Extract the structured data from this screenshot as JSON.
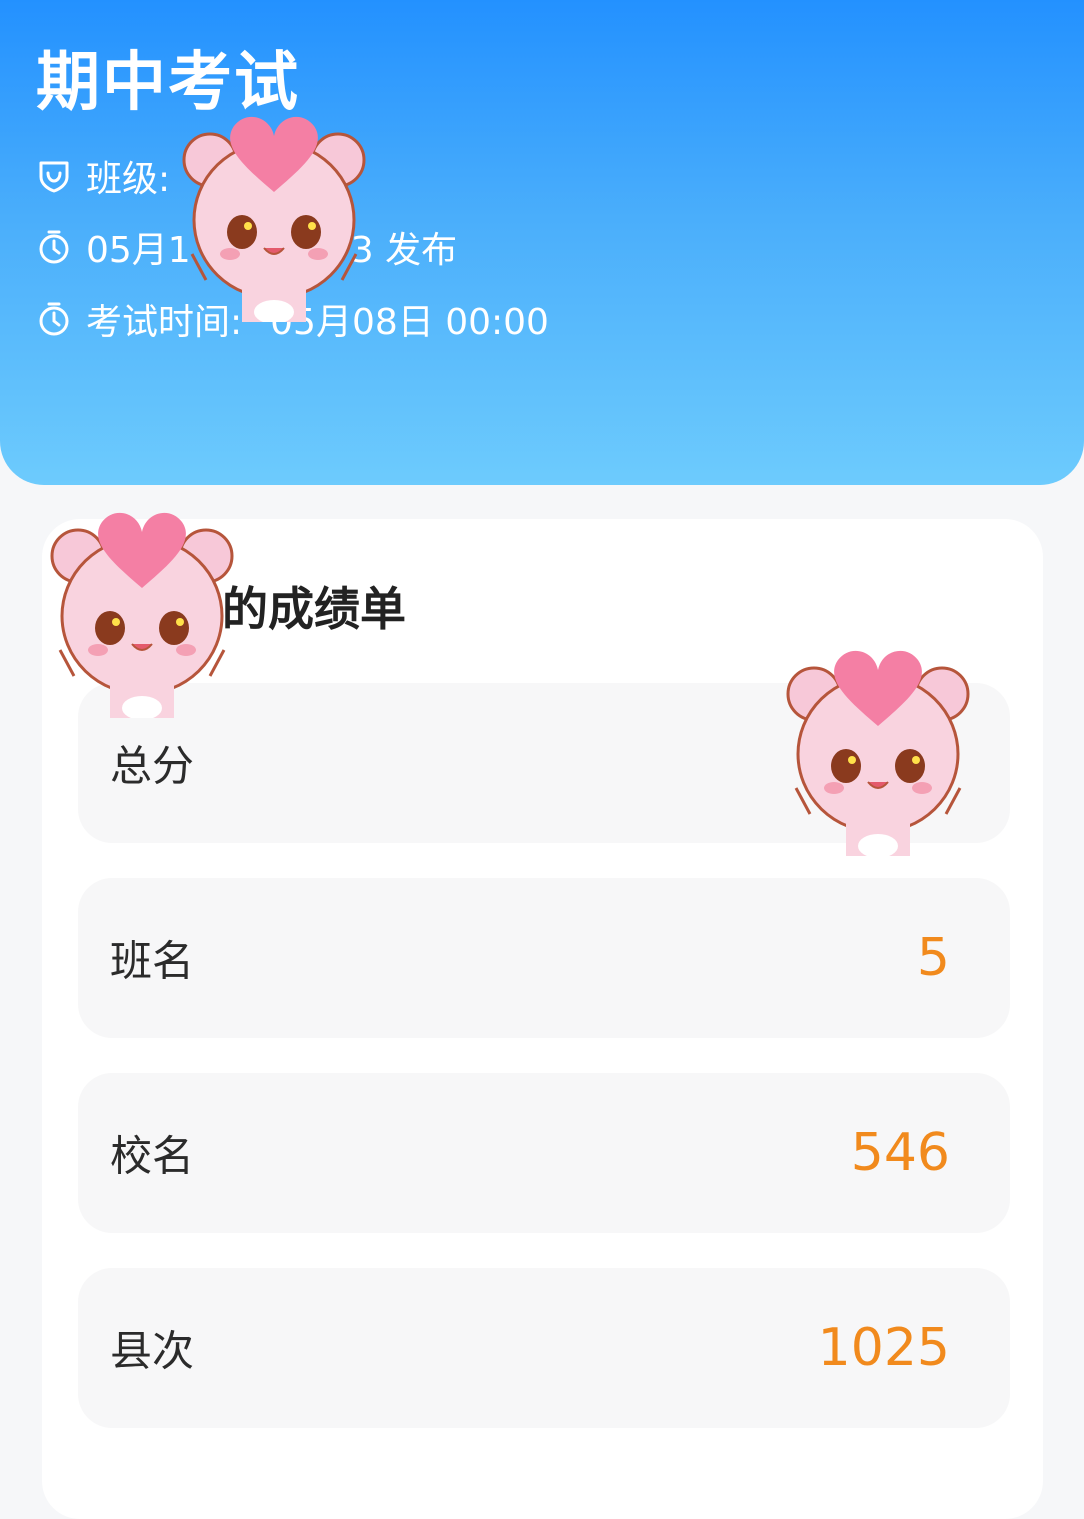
{
  "header": {
    "title": "期中考试",
    "class_label": "班级:",
    "publish_prefix": "05月1",
    "publish_suffix": "3 发布",
    "exam_time_label": "考试时间:",
    "exam_time_value": "05月08日 00:00",
    "icons": [
      "shield-icon",
      "stopwatch-icon",
      "stopwatch-icon"
    ]
  },
  "card": {
    "title": "的成绩单",
    "rows": [
      {
        "label": "总分",
        "value": ""
      },
      {
        "label": "班名",
        "value": "5"
      },
      {
        "label": "校名",
        "value": "546"
      },
      {
        "label": "县次",
        "value": "1025"
      }
    ]
  },
  "colors": {
    "header_top": "#2391ff",
    "header_bottom": "#6dcbfd",
    "value_orange": "#f18a1d",
    "sticker_pink": "#f7c8d8",
    "heart_pink": "#f47fa4"
  },
  "stickers": [
    "bear-heart-sticker",
    "bear-heart-sticker",
    "bear-heart-sticker"
  ]
}
